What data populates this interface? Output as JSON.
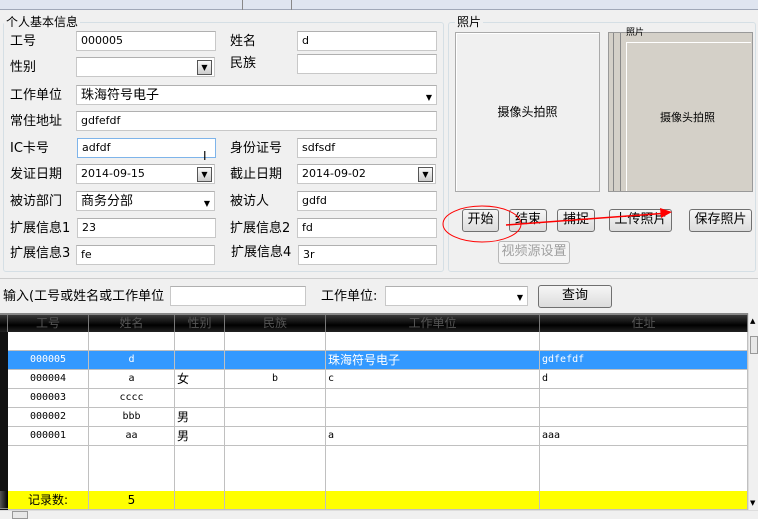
{
  "basic_info": {
    "title": "个人基本信息",
    "fields": {
      "employee_no": {
        "label": "工号",
        "value": "000005"
      },
      "name": {
        "label": "姓名",
        "value": "d"
      },
      "gender": {
        "label": "性别",
        "value": ""
      },
      "ethnicity": {
        "label": "民族",
        "value": ""
      },
      "work_unit": {
        "label": "工作单位",
        "value": "珠海符号电子"
      },
      "address": {
        "label": "常住地址",
        "value": "gdfefdf"
      },
      "ic_card": {
        "label": "IC卡号",
        "value": "adfdf"
      },
      "id_number": {
        "label": "身份证号",
        "value": "sdfsdf"
      },
      "issue_date": {
        "label": "发证日期",
        "value": "2014-09-15"
      },
      "expiry_date": {
        "label": "截止日期",
        "value": "2014-09-02"
      },
      "visited_dept": {
        "label": "被访部门",
        "value": "商务分部"
      },
      "visited_person": {
        "label": "被访人",
        "value": "gdfd"
      },
      "ext1": {
        "label": "扩展信息1",
        "value": "23"
      },
      "ext2": {
        "label": "扩展信息2",
        "value": "fd"
      },
      "ext3": {
        "label": "扩展信息3",
        "value": "fe"
      },
      "ext4": {
        "label": "扩展信息4",
        "value": "3r"
      }
    }
  },
  "photo": {
    "title": "照片",
    "camera_label": "摄像头拍照",
    "inner_title": "照片",
    "buttons": {
      "start": "开始",
      "stop": "结束",
      "capture": "捕捉",
      "upload": "上传照片",
      "save": "保存照片",
      "video_source": "视频源设置"
    }
  },
  "search": {
    "input_label": "输入(工号或姓名或工作单位",
    "input_value": "",
    "unit_label": "工作单位:",
    "unit_value": "",
    "query_button": "查询"
  },
  "grid": {
    "columns": [
      "工号",
      "姓名",
      "性别",
      "民族",
      "工作单位",
      "住址"
    ],
    "rows": [
      [
        "",
        "",
        "",
        "",
        "",
        ""
      ],
      [
        "000005",
        "d",
        "",
        "",
        "珠海符号电子",
        "gdfefdf"
      ],
      [
        "000004",
        "a",
        "女",
        "b",
        "c",
        "d"
      ],
      [
        "000003",
        "cccc",
        "",
        "",
        "",
        ""
      ],
      [
        "000002",
        "bbb",
        "男",
        "",
        "",
        ""
      ],
      [
        "000001",
        "aa",
        "男",
        "",
        "a",
        "aaa"
      ]
    ],
    "selected_row": 1,
    "footer": {
      "label": "记录数:",
      "count": "5"
    },
    "colors": {
      "selected": "#3399ff",
      "footer": "#ffff00",
      "header": "#000000"
    }
  },
  "annotation_color": "#ff0000"
}
